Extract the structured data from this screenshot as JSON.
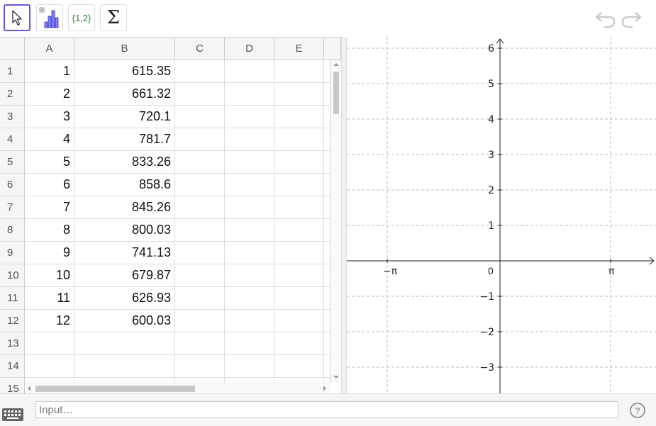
{
  "toolbar": {
    "tools": [
      {
        "name": "move-tool",
        "icon": "cursor-arrow-icon",
        "selected": true
      },
      {
        "name": "one-variable-analysis",
        "icon": "bar-chart-icon",
        "selected": false
      },
      {
        "name": "create-list",
        "label": "{1,2}",
        "icon": "list-icon",
        "selected": false
      },
      {
        "name": "sum",
        "label": "Σ",
        "icon": "sum-icon",
        "selected": false
      }
    ],
    "undo_icon": "undo-icon",
    "redo_icon": "redo-icon"
  },
  "spreadsheet": {
    "columns": [
      "A",
      "B",
      "C",
      "D",
      "E"
    ],
    "rows": [
      {
        "label": "1",
        "a": "1",
        "b": "615.35"
      },
      {
        "label": "2",
        "a": "2",
        "b": "661.32"
      },
      {
        "label": "3",
        "a": "3",
        "b": "720.1"
      },
      {
        "label": "4",
        "a": "4",
        "b": "781.7"
      },
      {
        "label": "5",
        "a": "5",
        "b": "833.26"
      },
      {
        "label": "6",
        "a": "6",
        "b": "858.6"
      },
      {
        "label": "7",
        "a": "7",
        "b": "845.26"
      },
      {
        "label": "8",
        "a": "8",
        "b": "800.03"
      },
      {
        "label": "9",
        "a": "9",
        "b": "741.13"
      },
      {
        "label": "10",
        "a": "10",
        "b": "679.87"
      },
      {
        "label": "11",
        "a": "11",
        "b": "626.93"
      },
      {
        "label": "12",
        "a": "12",
        "b": "600.03"
      },
      {
        "label": "13",
        "a": "",
        "b": ""
      },
      {
        "label": "14",
        "a": "",
        "b": ""
      },
      {
        "label": "15",
        "a": "",
        "b": ""
      }
    ]
  },
  "graphics": {
    "y_ticks": [
      "6",
      "5",
      "4",
      "3",
      "2",
      "1",
      "−1",
      "−2",
      "−3"
    ],
    "x_labels": {
      "neg_pi": "−π",
      "origin": "0",
      "pi": "π"
    },
    "grid": true
  },
  "input_bar": {
    "placeholder": "Input…",
    "keyboard_icon": "keyboard-icon",
    "help_label": "?"
  }
}
